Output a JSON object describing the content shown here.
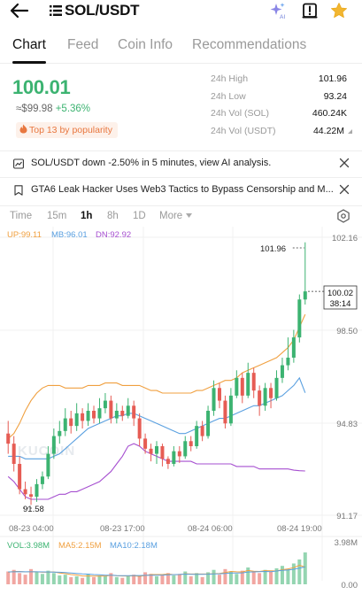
{
  "header": {
    "title": "SOL/USDT",
    "ai_badge": "AI"
  },
  "icons": {
    "back": "back-arrow-icon",
    "menu": "menu-lines-icon",
    "ai": "ai-sparkle-icon",
    "alert": "price-alert-icon",
    "favorite": "star-icon",
    "fire": "fire-icon",
    "ai_notice": "ai-analysis-icon",
    "news": "news-icon",
    "close": "close-icon",
    "settings": "settings-icon",
    "dropdown": "caret-down-icon"
  },
  "tabs": [
    "Chart",
    "Feed",
    "Coin Info",
    "Recommendations"
  ],
  "summary": {
    "last_price": "100.01",
    "usd_price": "≈$99.98",
    "change": "+5.36%",
    "popularity": "Top 13 by popularity"
  },
  "stats": [
    {
      "label": "24h High",
      "value": "101.96"
    },
    {
      "label": "24h Low",
      "value": "93.24"
    },
    {
      "label": "24h Vol (SOL)",
      "value": "460.24K"
    },
    {
      "label": "24h Vol (USDT)",
      "value": "44.22M"
    }
  ],
  "notices": [
    {
      "text": "SOL/USDT down -2.50% in 5 minutes, view AI analysis."
    },
    {
      "text": "GTA6 Leak Hacker Uses Web3 Tactics to Bypass Censorship and M..."
    }
  ],
  "timeframes": [
    "Time",
    "15m",
    "1h",
    "8h",
    "1D"
  ],
  "timeframe_more": "More",
  "active_timeframe": "1h",
  "colors": {
    "up": "#3cb371",
    "down": "#e65c54",
    "boll_up": "#f0a040",
    "boll_mb": "#5aa0e0",
    "boll_dn": "#a64fd0",
    "ma5": "#f0a040",
    "ma10": "#5aa0e0",
    "alert_orange": "#e8773f"
  },
  "chart_data": {
    "type": "candlestick",
    "indicator": {
      "up": "UP:99.11",
      "mb": "MB:96.01",
      "dn": "DN:92.92"
    },
    "price_axis": [
      "102.16",
      "98.50",
      "94.83",
      "91.17"
    ],
    "ylim": [
      91.17,
      102.16
    ],
    "time_axis": [
      "08-23 04:00",
      "08-23 17:00",
      "08-24 06:00",
      "08-24 19:00"
    ],
    "high_label": "101.96",
    "low_label": "91.58",
    "current_price_tag": "100.02",
    "countdown": "38:14",
    "watermark": "KUCOIN",
    "candles": [
      [
        94.4,
        94.0,
        94.9,
        93.6
      ],
      [
        94.0,
        93.2,
        94.3,
        92.9
      ],
      [
        93.2,
        92.2,
        93.5,
        92.0
      ],
      [
        92.2,
        92.0,
        92.5,
        91.8
      ],
      [
        92.0,
        91.9,
        92.3,
        91.58
      ],
      [
        91.9,
        92.4,
        92.6,
        91.7
      ],
      [
        92.4,
        92.7,
        92.9,
        92.2
      ],
      [
        92.7,
        93.6,
        93.9,
        92.6
      ],
      [
        93.6,
        94.3,
        94.6,
        93.4
      ],
      [
        94.3,
        94.5,
        94.9,
        94.0
      ],
      [
        94.5,
        95.0,
        95.4,
        94.3
      ],
      [
        95.0,
        94.7,
        95.3,
        94.4
      ],
      [
        94.7,
        95.2,
        95.6,
        94.5
      ],
      [
        95.2,
        94.9,
        95.4,
        94.6
      ],
      [
        94.9,
        95.3,
        95.6,
        94.7
      ],
      [
        95.3,
        95.0,
        95.5,
        94.8
      ],
      [
        95.0,
        95.4,
        95.8,
        94.8
      ],
      [
        95.4,
        95.7,
        96.0,
        95.2
      ],
      [
        95.7,
        95.0,
        95.9,
        94.8
      ],
      [
        95.0,
        95.3,
        95.6,
        94.8
      ],
      [
        95.3,
        95.1,
        95.5,
        94.9
      ],
      [
        95.1,
        95.5,
        95.8,
        95.0
      ],
      [
        95.5,
        95.0,
        95.7,
        94.7
      ],
      [
        95.0,
        94.2,
        95.2,
        93.9
      ],
      [
        94.2,
        93.8,
        94.4,
        93.6
      ],
      [
        93.8,
        93.6,
        94.0,
        93.3
      ],
      [
        93.6,
        93.9,
        94.1,
        93.2
      ],
      [
        93.9,
        93.4,
        94.0,
        93.1
      ],
      [
        93.4,
        93.2,
        93.5,
        93.0
      ],
      [
        93.2,
        93.7,
        93.9,
        93.1
      ],
      [
        93.7,
        93.5,
        93.9,
        93.24
      ],
      [
        93.5,
        94.1,
        94.3,
        93.4
      ],
      [
        94.1,
        93.9,
        94.3,
        93.7
      ],
      [
        93.9,
        94.7,
        94.9,
        93.8
      ],
      [
        94.7,
        94.3,
        94.9,
        94.1
      ],
      [
        94.3,
        95.3,
        95.5,
        94.2
      ],
      [
        95.3,
        96.2,
        96.5,
        95.1
      ],
      [
        96.2,
        95.7,
        96.4,
        95.4
      ],
      [
        95.7,
        94.8,
        95.9,
        94.6
      ],
      [
        94.8,
        95.9,
        96.2,
        94.7
      ],
      [
        95.9,
        96.6,
        96.9,
        95.8
      ],
      [
        96.6,
        95.9,
        96.8,
        95.6
      ],
      [
        95.9,
        96.8,
        97.2,
        95.8
      ],
      [
        96.8,
        96.1,
        97.0,
        95.8
      ],
      [
        96.1,
        95.5,
        96.3,
        95.1
      ],
      [
        95.5,
        96.2,
        96.4,
        95.3
      ],
      [
        96.2,
        95.8,
        96.4,
        95.4
      ],
      [
        95.8,
        96.6,
        96.9,
        95.7
      ],
      [
        96.6,
        97.1,
        97.4,
        96.4
      ],
      [
        97.1,
        97.4,
        98.2,
        96.9
      ],
      [
        97.4,
        98.2,
        98.5,
        97.2
      ],
      [
        98.2,
        99.7,
        99.9,
        98.0
      ],
      [
        99.7,
        100.02,
        101.96,
        99.5
      ]
    ],
    "boll_up": [
      94.2,
      94.4,
      94.8,
      95.3,
      95.7,
      96.0,
      96.2,
      96.3,
      96.3,
      96.3,
      96.2,
      96.2,
      96.2,
      96.2,
      96.3,
      96.3,
      96.3,
      96.4,
      96.4,
      96.4,
      96.3,
      96.3,
      96.3,
      96.3,
      96.2,
      96.1,
      96.1,
      96.0,
      96.0,
      96.0,
      96.0,
      96.0,
      96.0,
      96.1,
      96.1,
      96.2,
      96.3,
      96.4,
      96.5,
      96.5,
      96.6,
      96.8,
      96.9,
      97.0,
      97.1,
      97.2,
      97.3,
      97.4,
      97.6,
      97.8,
      98.1,
      98.6,
      99.11
    ],
    "boll_mid": [
      93.5,
      93.5,
      93.5,
      93.4,
      93.4,
      93.4,
      93.4,
      93.4,
      93.5,
      93.6,
      93.8,
      94.0,
      94.2,
      94.4,
      94.6,
      94.7,
      94.8,
      94.9,
      95.0,
      95.1,
      95.1,
      95.2,
      95.2,
      95.1,
      95.0,
      94.9,
      94.8,
      94.7,
      94.6,
      94.5,
      94.4,
      94.4,
      94.5,
      94.6,
      94.7,
      94.8,
      94.9,
      95.0,
      95.0,
      95.1,
      95.2,
      95.3,
      95.4,
      95.5,
      95.5,
      95.6,
      95.7,
      95.8,
      95.9,
      96.1,
      96.3,
      96.6,
      96.01
    ],
    "boll_dn": [
      92.7,
      92.5,
      92.2,
      91.9,
      91.8,
      91.8,
      91.8,
      91.8,
      91.9,
      92.0,
      92.0,
      92.1,
      92.1,
      92.2,
      92.3,
      92.4,
      92.5,
      92.7,
      92.9,
      93.2,
      93.5,
      93.9,
      94.0,
      93.9,
      93.7,
      93.6,
      93.5,
      93.4,
      93.3,
      93.3,
      93.3,
      93.3,
      93.3,
      93.2,
      93.2,
      93.2,
      93.2,
      93.2,
      93.2,
      93.2,
      93.1,
      93.1,
      93.1,
      93.1,
      93.0,
      93.0,
      93.0,
      93.0,
      93.0,
      93.0,
      92.95,
      92.93,
      92.92
    ]
  },
  "volume": {
    "label_vol": "VOL:3.98M",
    "label_ma5": "MA5:2.15M",
    "label_ma10": "MA10:2.18M",
    "axis_max": "3.98M",
    "axis_min": "0.00",
    "max_value": 3.98,
    "values": [
      1.6,
      1.8,
      1.4,
      1.2,
      1.9,
      1.5,
      1.3,
      1.7,
      1.4,
      1.1,
      1.2,
      0.9,
      1.0,
      0.8,
      1.3,
      0.9,
      1.1,
      1.0,
      1.4,
      0.9,
      0.8,
      1.0,
      1.2,
      1.1,
      1.5,
      1.3,
      1.0,
      1.2,
      1.4,
      1.1,
      1.3,
      1.6,
      1.0,
      1.4,
      0.9,
      1.5,
      1.8,
      1.2,
      1.9,
      1.6,
      1.3,
      1.7,
      2.1,
      1.5,
      1.4,
      1.8,
      1.6,
      2.0,
      2.3,
      1.9,
      2.6,
      3.1,
      3.98
    ],
    "ma5": [
      1.5,
      1.6,
      1.6,
      1.55,
      1.58,
      1.56,
      1.5,
      1.52,
      1.55,
      1.4,
      1.34,
      1.22,
      1.16,
      1.04,
      1.04,
      1.02,
      1.02,
      1.02,
      1.14,
      1.06,
      1.04,
      1.04,
      1.06,
      1.0,
      1.1,
      1.22,
      1.22,
      1.22,
      1.28,
      1.2,
      1.2,
      1.32,
      1.28,
      1.28,
      1.28,
      1.28,
      1.32,
      1.36,
      1.46,
      1.6,
      1.56,
      1.54,
      1.72,
      1.64,
      1.6,
      1.7,
      1.68,
      1.66,
      1.82,
      1.92,
      2.08,
      2.38,
      2.15
    ],
    "ma10": [
      1.55,
      1.56,
      1.57,
      1.56,
      1.56,
      1.56,
      1.55,
      1.54,
      1.53,
      1.5,
      1.46,
      1.41,
      1.36,
      1.3,
      1.27,
      1.22,
      1.18,
      1.13,
      1.14,
      1.1,
      1.08,
      1.08,
      1.09,
      1.1,
      1.12,
      1.14,
      1.13,
      1.15,
      1.19,
      1.2,
      1.23,
      1.27,
      1.25,
      1.25,
      1.24,
      1.26,
      1.31,
      1.32,
      1.36,
      1.42,
      1.42,
      1.43,
      1.54,
      1.55,
      1.57,
      1.6,
      1.58,
      1.66,
      1.74,
      1.78,
      1.88,
      2.02,
      2.18
    ]
  }
}
